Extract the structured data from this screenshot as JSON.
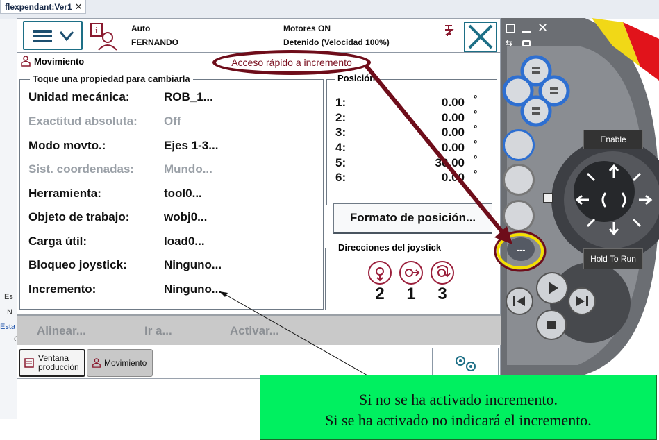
{
  "host": {
    "tab_label": "flexpendant:Ver1",
    "tab_close": "✕",
    "left_fragments": [
      "Es",
      "N",
      "Esta",
      "C"
    ]
  },
  "status": {
    "mode": "Auto",
    "user": "FERNANDO",
    "motors": "Motores ON",
    "state": "Detenido (Velocidad 100%)"
  },
  "window_title": "Movimiento",
  "properties": {
    "title": "Toque una propiedad para cambiarla",
    "rows": [
      {
        "label": "Unidad mecánica:",
        "value": "ROB_1...",
        "enabled": true
      },
      {
        "label": "Exactitud absoluta:",
        "value": "Off",
        "enabled": false
      },
      {
        "label": "Modo movto.:",
        "value": "Ejes 1-3...",
        "enabled": true
      },
      {
        "label": "Sist. coordenadas:",
        "value": "Mundo...",
        "enabled": false
      },
      {
        "label": "Herramienta:",
        "value": "tool0...",
        "enabled": true
      },
      {
        "label": "Objeto de trabajo:",
        "value": "wobj0...",
        "enabled": true
      },
      {
        "label": "Carga útil:",
        "value": "load0...",
        "enabled": true
      },
      {
        "label": "Bloqueo joystick:",
        "value": "Ninguno...",
        "enabled": true
      },
      {
        "label": "Incremento:",
        "value": "Ninguno...",
        "enabled": true
      }
    ]
  },
  "position": {
    "title": "Posición",
    "rows": [
      {
        "n": "1:",
        "v": "0.00",
        "u": "º"
      },
      {
        "n": "2:",
        "v": "0.00",
        "u": "º"
      },
      {
        "n": "3:",
        "v": "0.00",
        "u": "º"
      },
      {
        "n": "4:",
        "v": "0.00",
        "u": "º"
      },
      {
        "n": "5:",
        "v": "30.00",
        "u": "º"
      },
      {
        "n": "6:",
        "v": "0.00",
        "u": "º"
      }
    ],
    "format_button": "Formato de posición..."
  },
  "joystick": {
    "title": "Direcciones del joystick",
    "axes": [
      "2",
      "1",
      "3"
    ]
  },
  "actions": {
    "align": "Alinear...",
    "goto": "Ir a...",
    "activate": "Activar..."
  },
  "taskbar": {
    "production_line1": "Ventana",
    "production_line2": "producción",
    "movement": "Movimiento"
  },
  "callout": "Acceso rápido a incremento",
  "note": {
    "line1": "Si no se ha activado incremento.",
    "line2": "Si se ha activado no indicará el incremento."
  },
  "device": {
    "enable_label": "Enable",
    "hold_to_run_label": "Hold To Run",
    "increment_glyph": "---",
    "icons": [
      "window-icon",
      "minimize-icon",
      "close-icon",
      "swap-icon",
      "camera-icon"
    ]
  },
  "colors": {
    "accent": "#1d6f86",
    "callout": "#6e0d1a",
    "note_bg": "#00f060",
    "device_blue": "#2e6fd1",
    "highlight_ring": "#f4df00"
  }
}
